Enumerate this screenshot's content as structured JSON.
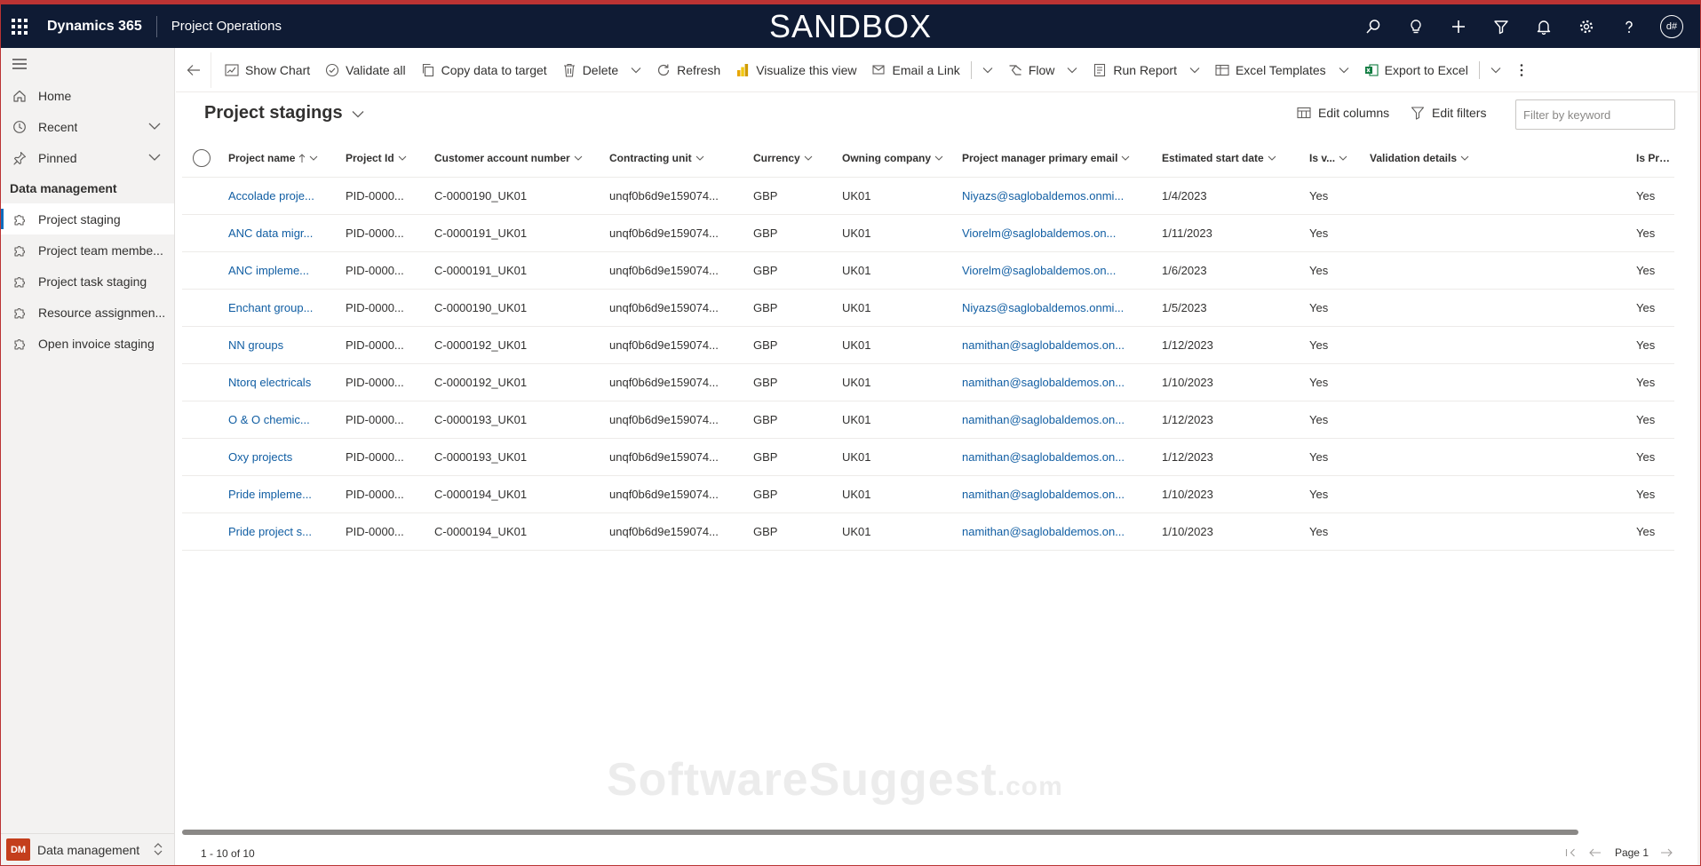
{
  "topbar": {
    "brand": "Dynamics 365",
    "app_name": "Project Operations",
    "environment": "SANDBOX",
    "user_initials": "d#",
    "icons": [
      "search-icon",
      "lightbulb-icon",
      "plus-icon",
      "filter-icon",
      "bell-icon",
      "gear-icon",
      "help-icon"
    ]
  },
  "sidebar": {
    "items": [
      {
        "label": "Home",
        "icon": "home-icon"
      },
      {
        "label": "Recent",
        "icon": "clock-icon"
      },
      {
        "label": "Pinned",
        "icon": "pin-icon"
      }
    ],
    "group_title": "Data management",
    "group_items": [
      {
        "label": "Project staging",
        "icon": "puzzle-icon",
        "active": true
      },
      {
        "label": "Project team membe...",
        "icon": "puzzle-icon"
      },
      {
        "label": "Project task staging",
        "icon": "puzzle-icon"
      },
      {
        "label": "Resource assignmen...",
        "icon": "puzzle-icon"
      },
      {
        "label": "Open invoice staging",
        "icon": "puzzle-icon"
      }
    ],
    "area": {
      "badge": "DM",
      "label": "Data management",
      "badge_color": "#c43e1c"
    }
  },
  "commands": {
    "show_chart": "Show Chart",
    "validate_all": "Validate all",
    "copy_data": "Copy data to target",
    "delete": "Delete",
    "refresh": "Refresh",
    "visualize": "Visualize this view",
    "email_link": "Email a Link",
    "flow": "Flow",
    "run_report": "Run Report",
    "excel_templates": "Excel Templates",
    "export_excel": "Export to Excel"
  },
  "view": {
    "title": "Project stagings",
    "edit_columns": "Edit columns",
    "edit_filters": "Edit filters",
    "search_placeholder": "Filter by keyword"
  },
  "grid": {
    "columns": [
      "Project name",
      "Project Id",
      "Customer account number",
      "Contracting unit",
      "Currency",
      "Owning company",
      "Project manager primary email",
      "Estimated start date",
      "Is v...",
      "Validation details",
      "Is Proce"
    ],
    "rows": [
      [
        "Accolade proje...",
        "PID-0000...",
        "C-0000190_UK01",
        "unqf0b6d9e159074...",
        "GBP",
        "UK01",
        "Niyazs@saglobaldemos.onmi...",
        "1/4/2023",
        "Yes",
        "",
        "Yes"
      ],
      [
        "ANC data migr...",
        "PID-0000...",
        "C-0000191_UK01",
        "unqf0b6d9e159074...",
        "GBP",
        "UK01",
        "Viorelm@saglobaldemos.on...",
        "1/11/2023",
        "Yes",
        "",
        "Yes"
      ],
      [
        "ANC impleme...",
        "PID-0000...",
        "C-0000191_UK01",
        "unqf0b6d9e159074...",
        "GBP",
        "UK01",
        "Viorelm@saglobaldemos.on...",
        "1/6/2023",
        "Yes",
        "",
        "Yes"
      ],
      [
        "Enchant group...",
        "PID-0000...",
        "C-0000190_UK01",
        "unqf0b6d9e159074...",
        "GBP",
        "UK01",
        "Niyazs@saglobaldemos.onmi...",
        "1/5/2023",
        "Yes",
        "",
        "Yes"
      ],
      [
        "NN groups",
        "PID-0000...",
        "C-0000192_UK01",
        "unqf0b6d9e159074...",
        "GBP",
        "UK01",
        "namithan@saglobaldemos.on...",
        "1/12/2023",
        "Yes",
        "",
        "Yes"
      ],
      [
        "Ntorq electricals",
        "PID-0000...",
        "C-0000192_UK01",
        "unqf0b6d9e159074...",
        "GBP",
        "UK01",
        "namithan@saglobaldemos.on...",
        "1/10/2023",
        "Yes",
        "",
        "Yes"
      ],
      [
        "O & O chemic...",
        "PID-0000...",
        "C-0000193_UK01",
        "unqf0b6d9e159074...",
        "GBP",
        "UK01",
        "namithan@saglobaldemos.on...",
        "1/12/2023",
        "Yes",
        "",
        "Yes"
      ],
      [
        "Oxy projects",
        "PID-0000...",
        "C-0000193_UK01",
        "unqf0b6d9e159074...",
        "GBP",
        "UK01",
        "namithan@saglobaldemos.on...",
        "1/12/2023",
        "Yes",
        "",
        "Yes"
      ],
      [
        "Pride impleme...",
        "PID-0000...",
        "C-0000194_UK01",
        "unqf0b6d9e159074...",
        "GBP",
        "UK01",
        "namithan@saglobaldemos.on...",
        "1/10/2023",
        "Yes",
        "",
        "Yes"
      ],
      [
        "Pride project s...",
        "PID-0000...",
        "C-0000194_UK01",
        "unqf0b6d9e159074...",
        "GBP",
        "UK01",
        "namithan@saglobaldemos.on...",
        "1/10/2023",
        "Yes",
        "",
        "Yes"
      ]
    ]
  },
  "footer": {
    "record_count": "1 - 10 of 10",
    "page_label": "Page 1"
  },
  "watermark": {
    "main": "SoftwareSuggest",
    "suffix": ".com"
  },
  "colors": {
    "topbar": "#0f1b34",
    "link": "#115ea3",
    "accent": "#0f6cbd"
  }
}
